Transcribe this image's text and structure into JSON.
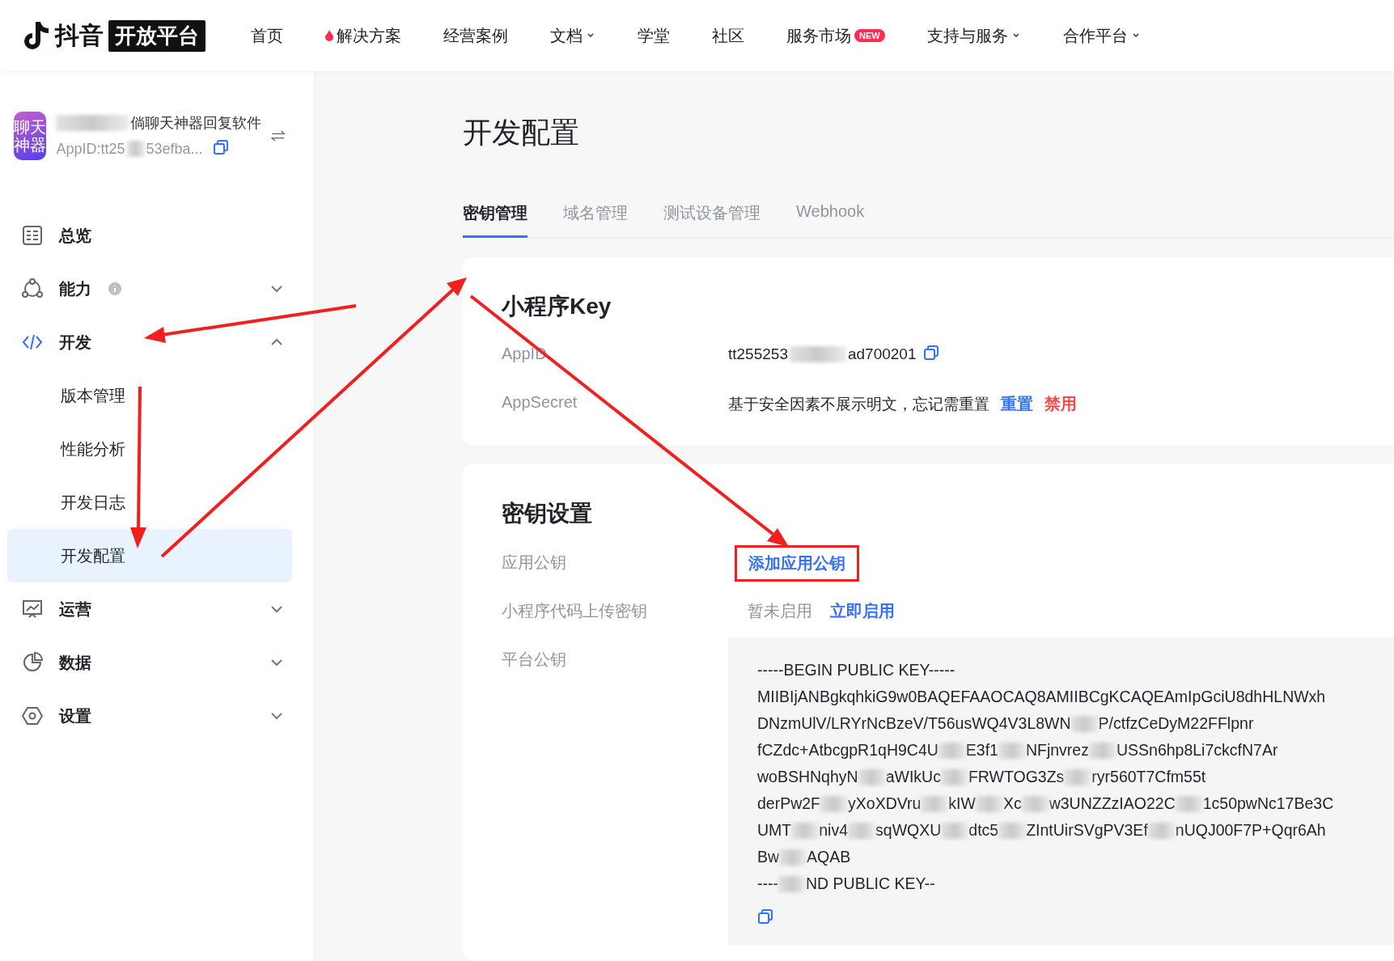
{
  "header": {
    "logo": {
      "brand": "抖音",
      "platform": "开放平台"
    },
    "nav": [
      {
        "label": "首页",
        "kind": "plain"
      },
      {
        "label": "解决方案",
        "kind": "hot"
      },
      {
        "label": "经营案例",
        "kind": "plain"
      },
      {
        "label": "文档",
        "kind": "dropdown"
      },
      {
        "label": "学堂",
        "kind": "plain"
      },
      {
        "label": "社区",
        "kind": "plain"
      },
      {
        "label": "服务市场",
        "kind": "badge",
        "badge": "NEW"
      },
      {
        "label": "支持与服务",
        "kind": "dropdown"
      },
      {
        "label": "合作平台",
        "kind": "dropdown"
      }
    ]
  },
  "app": {
    "avatar_lines": [
      "聊天",
      "神器"
    ],
    "name": "倘聊天神器回复软件",
    "appid_parts": [
      "AppID:tt25",
      "53efba..."
    ]
  },
  "sidebar": {
    "items": [
      {
        "label": "总览",
        "kind": "link"
      },
      {
        "label": "能力",
        "kind": "group",
        "info": true,
        "expanded": false
      },
      {
        "label": "开发",
        "kind": "group",
        "info": false,
        "expanded": true,
        "children": [
          {
            "label": "版本管理",
            "selected": false
          },
          {
            "label": "性能分析",
            "selected": false
          },
          {
            "label": "开发日志",
            "selected": false
          },
          {
            "label": "开发配置",
            "selected": true
          }
        ]
      },
      {
        "label": "运营",
        "kind": "group",
        "info": false,
        "expanded": false
      },
      {
        "label": "数据",
        "kind": "group",
        "info": false,
        "expanded": false
      },
      {
        "label": "设置",
        "kind": "group",
        "info": false,
        "expanded": false
      }
    ]
  },
  "page": {
    "title": "开发配置",
    "tabs": [
      {
        "label": "密钥管理",
        "selected": true
      },
      {
        "label": "域名管理",
        "selected": false
      },
      {
        "label": "测试设备管理",
        "selected": false
      },
      {
        "label": "Webhook",
        "selected": false
      }
    ],
    "key_card": {
      "title": "小程序Key",
      "rows": [
        {
          "label": "AppID",
          "kind": "copyable",
          "value_parts": [
            "tt255253",
            "ad700201"
          ]
        },
        {
          "label": "AppSecret",
          "kind": "secret",
          "text": "基于安全因素不展示明文，忘记需重置",
          "actions": [
            {
              "label": "重置",
              "color": "#3370ff"
            },
            {
              "label": "禁用",
              "color": "#f54a45"
            }
          ]
        }
      ]
    },
    "settings_card": {
      "title": "密钥设置",
      "rows": [
        {
          "label": "应用公钥",
          "kind": "link",
          "link": {
            "label": "添加应用公钥",
            "highlighted": true
          }
        },
        {
          "label": "小程序代码上传密钥",
          "kind": "status",
          "status": "暂未启用",
          "action": "立即启用"
        },
        {
          "label": "平台公钥",
          "kind": "key",
          "lines": [
            {
              "parts": [
                "-----BEGIN PUBLIC KEY-----"
              ]
            },
            {
              "parts": [
                "MIIBIjANBgkqhkiG9w0BAQEFAAOCAQ8AMIIBCgKCAQEAmIpGciU8dhHLNWxh"
              ]
            },
            {
              "parts": [
                "DNzmUlV/LRYrNcBzeV/T56usWQ4V3L8WN",
                "P/ctfzCeDyM22FFlpnr"
              ]
            },
            {
              "parts": [
                "fCZdc+AtbcgpR1qH9C4U",
                "E3f1",
                "NFjnvrez",
                "USSn6hp8Li7ckcfN7Ar"
              ]
            },
            {
              "parts": [
                "woBSHNqhyN",
                "aWIkUc",
                "FRWTOG3Zs",
                "ryr560T7Cfm55t"
              ]
            },
            {
              "parts": [
                "derPw2F",
                "yXoXDVru",
                "kIW",
                "Xc",
                "w3UNZZzIAO22C",
                "1c50pwNc17Be3C"
              ]
            },
            {
              "parts": [
                "UMT",
                "niv4",
                "sqWQXU",
                "dtc5",
                "ZIntUirSVgPV3Ef",
                "nUQJ00F7P+Qqr6Ah"
              ]
            },
            {
              "parts": [
                "Bw",
                "AQAB"
              ]
            },
            {
              "parts": [
                "----",
                "ND PUBLIC KEY--"
              ]
            }
          ]
        }
      ]
    }
  }
}
